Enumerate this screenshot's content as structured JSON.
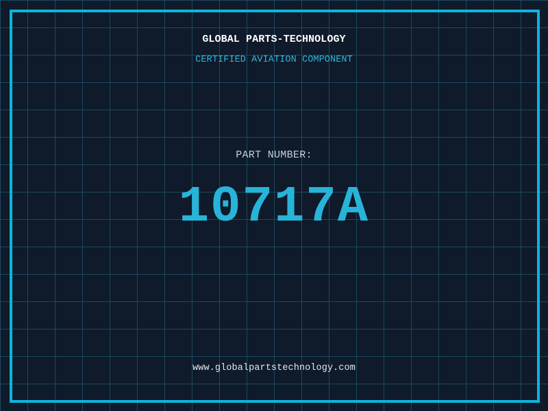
{
  "header": {
    "title": "GLOBAL PARTS-TECHNOLOGY",
    "subtitle": "CERTIFIED AVIATION COMPONENT"
  },
  "part": {
    "label": "PART NUMBER:",
    "number": "10717A"
  },
  "footer": {
    "url": "www.globalpartstechnology.com"
  },
  "colors": {
    "background": "#0f1a2a",
    "grid_line": "#1b4a5f",
    "frame": "#0db4dd",
    "title_text": "#ffffff",
    "subtitle_text": "#2fb7da",
    "label_text": "#c4cfd7",
    "part_number_text": "#28b4d8",
    "url_text": "#e2e9ec"
  }
}
